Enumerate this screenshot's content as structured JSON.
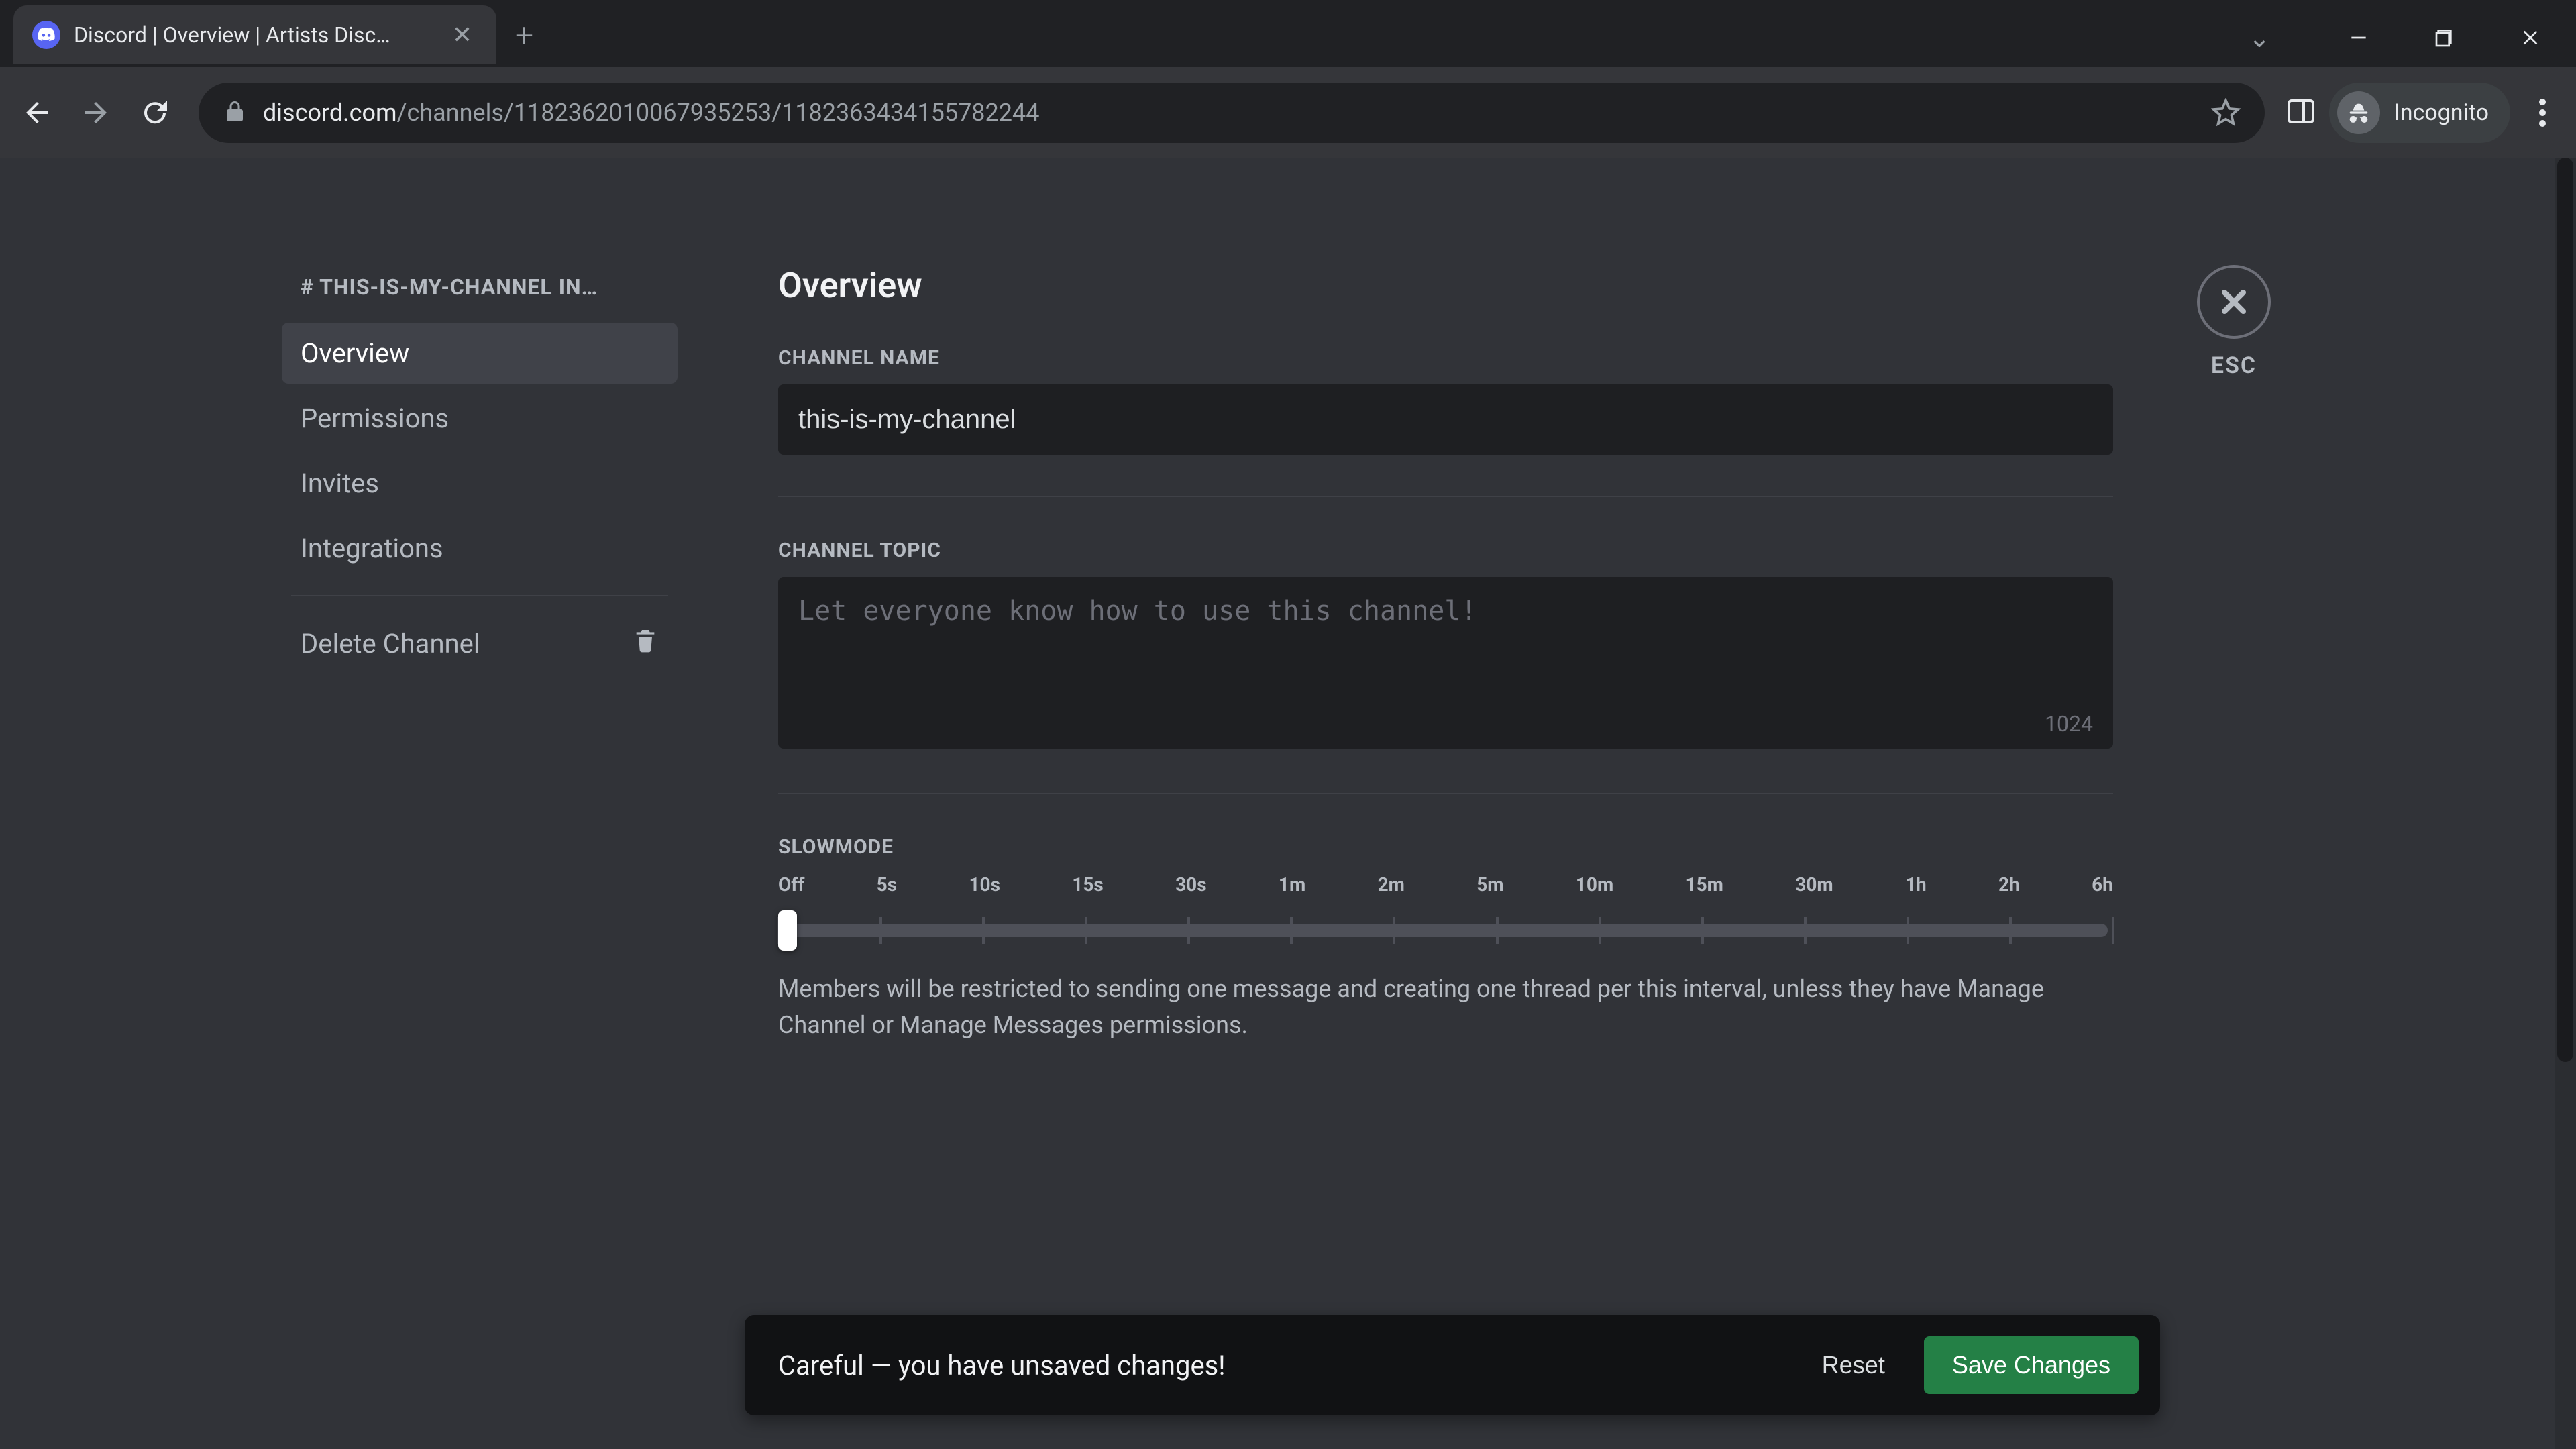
{
  "browser": {
    "tab_title": "Discord | Overview | Artists Disc…",
    "url_domain": "discord.com",
    "url_path": "/channels/1182362010067935253/1182363434155782244",
    "incognito_label": "Incognito"
  },
  "sidebar": {
    "heading": "# THIS-IS-MY-CHANNEL IN…",
    "items": [
      {
        "label": "Overview",
        "selected": true
      },
      {
        "label": "Permissions",
        "selected": false
      },
      {
        "label": "Invites",
        "selected": false
      },
      {
        "label": "Integrations",
        "selected": false
      }
    ],
    "delete_label": "Delete Channel"
  },
  "page": {
    "title": "Overview",
    "esc_label": "ESC",
    "channel_name": {
      "label": "CHANNEL NAME",
      "value": "this-is-my-channel"
    },
    "channel_topic": {
      "label": "CHANNEL TOPIC",
      "placeholder": "Let everyone know how to use this channel!",
      "value": "",
      "char_limit": "1024"
    },
    "slowmode": {
      "label": "SLOWMODE",
      "ticks": [
        "Off",
        "5s",
        "10s",
        "15s",
        "30s",
        "1m",
        "2m",
        "5m",
        "10m",
        "15m",
        "30m",
        "1h",
        "2h",
        "6h"
      ],
      "current_index": 0,
      "help": "Members will be restricted to sending one message and creating one thread per this interval, unless they have Manage Channel or Manage Messages permissions."
    }
  },
  "unsaved_toast": {
    "message": "Careful — you have unsaved changes!",
    "reset_label": "Reset",
    "save_label": "Save Changes"
  },
  "colors": {
    "accent_green": "#248046",
    "discord_bg": "#313338",
    "input_bg": "#1e1f22"
  }
}
